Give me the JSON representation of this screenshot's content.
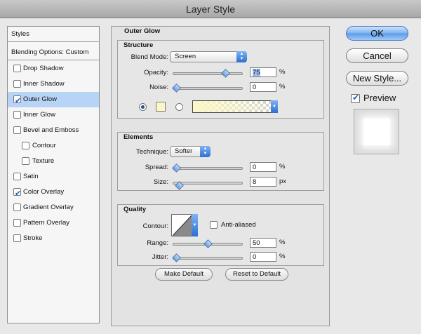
{
  "window": {
    "title": "Layer Style"
  },
  "styles_panel": {
    "header": "Styles",
    "blending_options": "Blending Options: Custom",
    "items": [
      {
        "label": "Drop Shadow",
        "checked": false,
        "indent": false,
        "selected": false
      },
      {
        "label": "Inner Shadow",
        "checked": false,
        "indent": false,
        "selected": false
      },
      {
        "label": "Outer Glow",
        "checked": true,
        "indent": false,
        "selected": true
      },
      {
        "label": "Inner Glow",
        "checked": false,
        "indent": false,
        "selected": false
      },
      {
        "label": "Bevel and Emboss",
        "checked": false,
        "indent": false,
        "selected": false
      },
      {
        "label": "Contour",
        "checked": false,
        "indent": true,
        "selected": false
      },
      {
        "label": "Texture",
        "checked": false,
        "indent": true,
        "selected": false
      },
      {
        "label": "Satin",
        "checked": false,
        "indent": false,
        "selected": false
      },
      {
        "label": "Color Overlay",
        "checked": true,
        "indent": false,
        "selected": false
      },
      {
        "label": "Gradient Overlay",
        "checked": false,
        "indent": false,
        "selected": false
      },
      {
        "label": "Pattern Overlay",
        "checked": false,
        "indent": false,
        "selected": false
      },
      {
        "label": "Stroke",
        "checked": false,
        "indent": false,
        "selected": false
      }
    ]
  },
  "outer_glow": {
    "title": "Outer Glow",
    "structure": {
      "title": "Structure",
      "blend_mode_label": "Blend Mode:",
      "blend_mode_value": "Screen",
      "opacity_label": "Opacity:",
      "opacity_value": "75",
      "opacity_level_pct": 75,
      "noise_label": "Noise:",
      "noise_value": "0",
      "noise_level_pct": 0,
      "percent": "%",
      "glow_color": "#fbf7c6"
    },
    "elements": {
      "title": "Elements",
      "technique_label": "Technique:",
      "technique_value": "Softer",
      "spread_label": "Spread:",
      "spread_value": "0",
      "spread_level_pct": 0,
      "size_label": "Size:",
      "size_value": "8",
      "size_unit": "px",
      "percent": "%"
    },
    "quality": {
      "title": "Quality",
      "contour_label": "Contour:",
      "anti_aliased_label": "Anti-aliased",
      "range_label": "Range:",
      "range_value": "50",
      "range_level_pct": 50,
      "jitter_label": "Jitter:",
      "jitter_value": "0",
      "jitter_level_pct": 0,
      "percent": "%"
    },
    "make_default": "Make Default",
    "reset_to_default": "Reset to Default"
  },
  "buttons": {
    "ok": "OK",
    "cancel": "Cancel",
    "new_style": "New Style...",
    "preview": "Preview"
  }
}
